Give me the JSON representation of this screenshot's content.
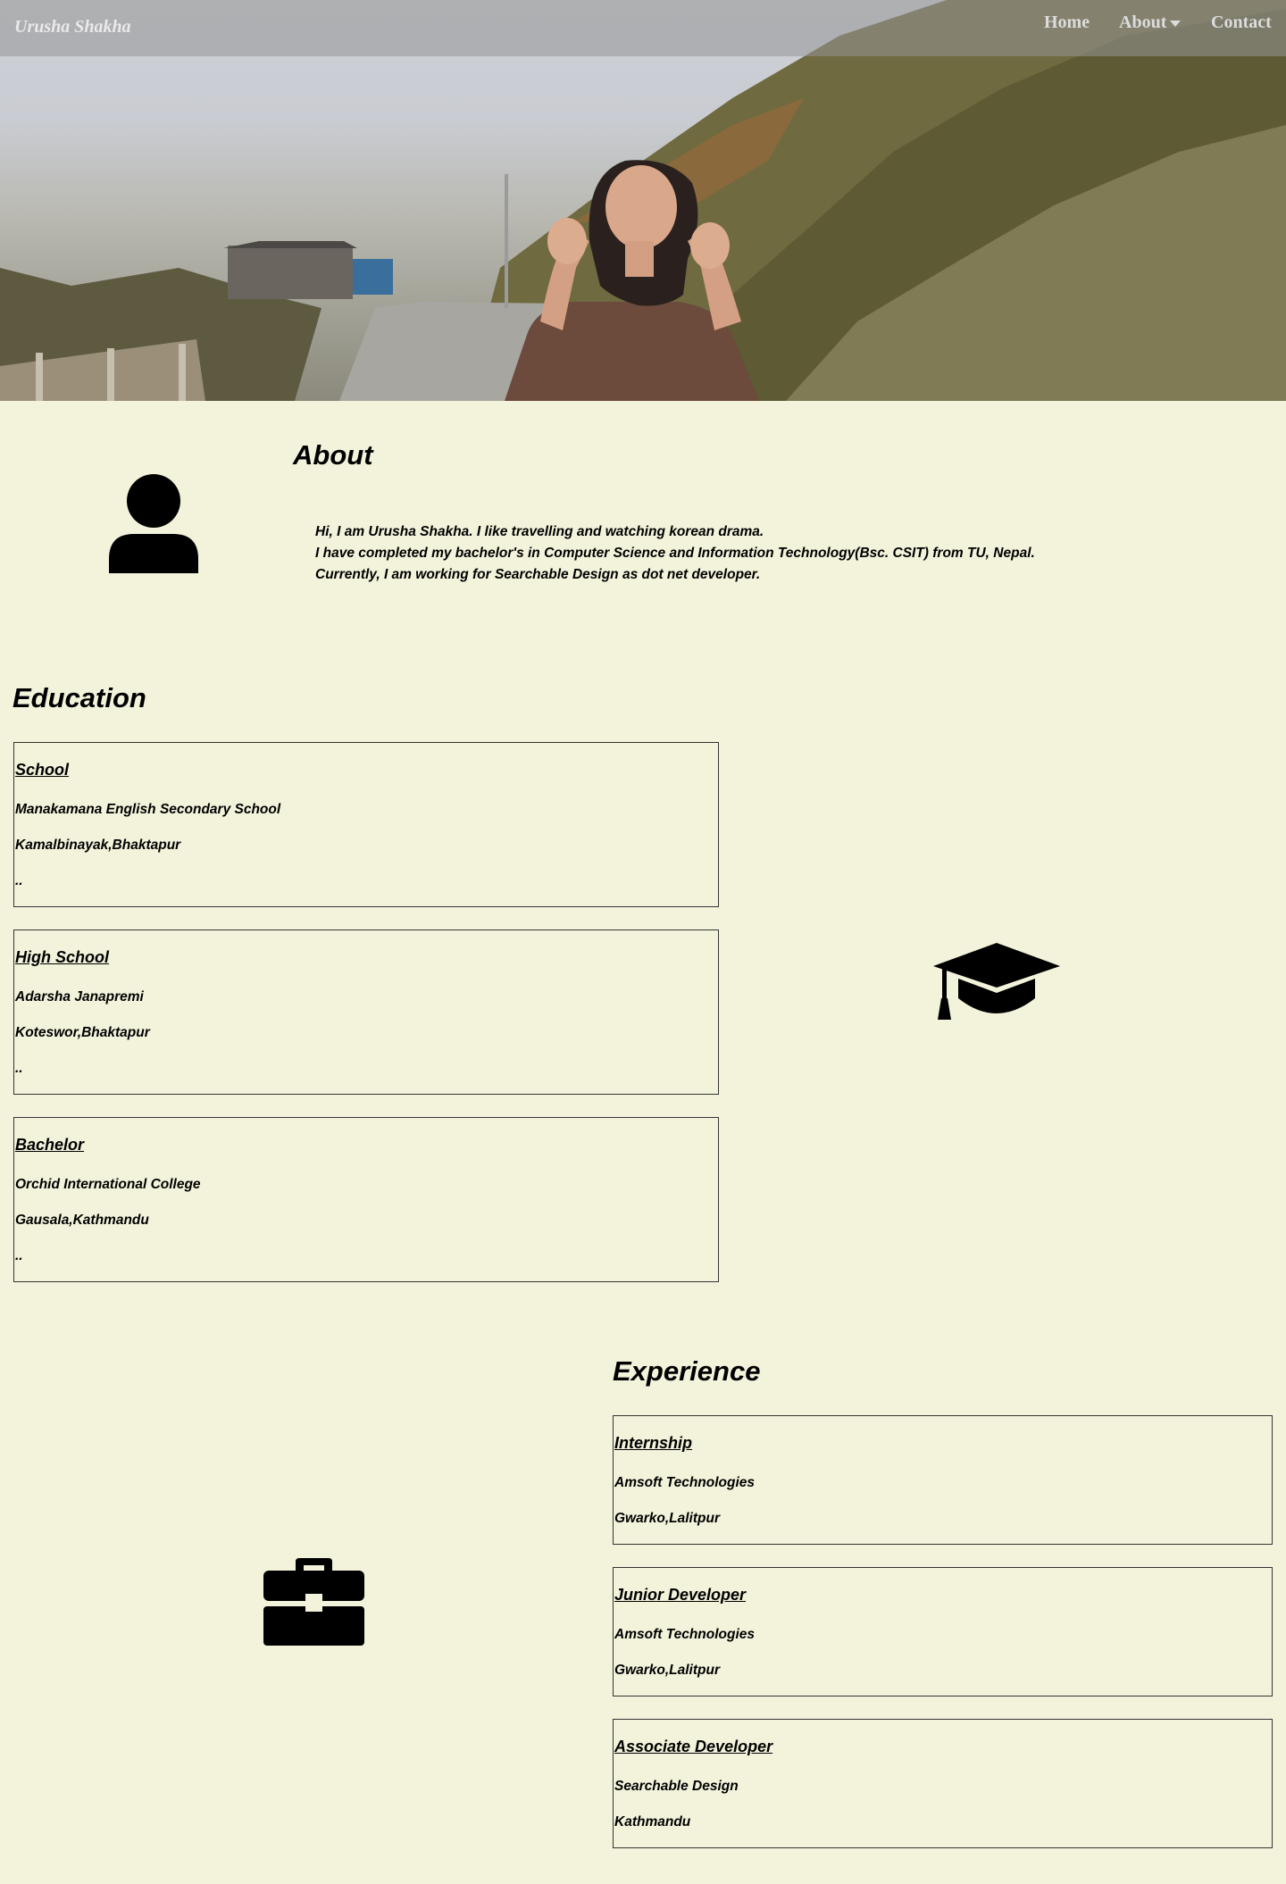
{
  "navbar": {
    "brand": "Urusha Shakha",
    "items": [
      {
        "label": "Home"
      },
      {
        "label": "About",
        "has_dropdown": true
      },
      {
        "label": "Contact"
      }
    ]
  },
  "hero": {
    "image": "woman-on-mountain-road-photo"
  },
  "about": {
    "title": "About",
    "icon": "user-icon",
    "paragraphs": [
      "Hi, I am Urusha Shakha. I like travelling and watching korean drama.",
      "I have completed my bachelor's in Computer Science and Information Technology(Bsc. CSIT) from TU, Nepal.",
      "Currently, I am working for Searchable Design as dot net developer."
    ]
  },
  "education": {
    "title": "Education",
    "icon": "graduation-cap-icon",
    "items": [
      {
        "title": "School",
        "institution": "Manakamana English Secondary School",
        "location": "Kamalbinayak,Bhaktapur",
        "extra": ".."
      },
      {
        "title": "High School",
        "institution": "Adarsha Janapremi",
        "location": "Koteswor,Bhaktapur",
        "extra": ".."
      },
      {
        "title": "Bachelor",
        "institution": "Orchid International College",
        "location": "Gausala,Kathmandu",
        "extra": ".."
      }
    ]
  },
  "experience": {
    "title": "Experience",
    "icon": "briefcase-icon",
    "items": [
      {
        "title": "Internship",
        "company": "Amsoft Technologies",
        "location": "Gwarko,Lalitpur"
      },
      {
        "title": "Junior Developer",
        "company": "Amsoft Technologies",
        "location": "Gwarko,Lalitpur"
      },
      {
        "title": "Associate Developer",
        "company": "Searchable Design",
        "location": "Kathmandu"
      }
    ]
  },
  "colors": {
    "background": "#f3f3dc",
    "navbar": "#969696"
  }
}
